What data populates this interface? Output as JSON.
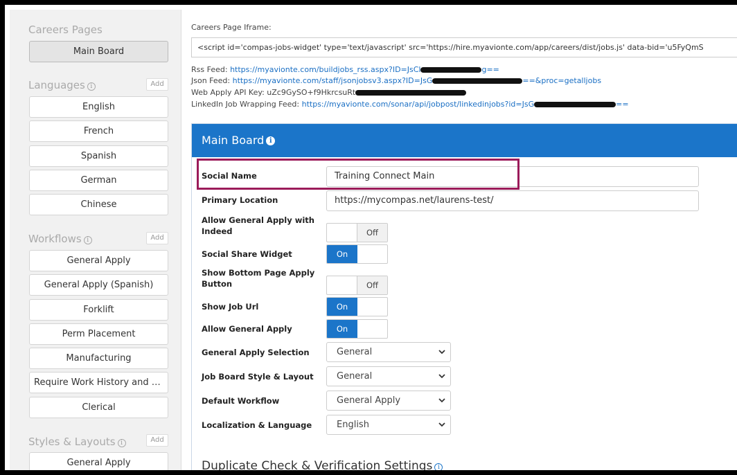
{
  "sidebar": {
    "careers_title": "Careers Pages",
    "careers_items": [
      "Main Board"
    ],
    "languages_title": "Languages",
    "languages_add": "Add",
    "languages": [
      "English",
      "French",
      "Spanish",
      "German",
      "Chinese"
    ],
    "workflows_title": "Workflows",
    "workflows_add": "Add",
    "workflows": [
      "General Apply",
      "General Apply (Spanish)",
      "Forklift",
      "Perm Placement",
      "Manufacturing",
      "Require Work History and E...",
      "Clerical"
    ],
    "styles_title": "Styles & Layouts",
    "styles_add": "Add",
    "styles": [
      "General Apply"
    ]
  },
  "main": {
    "iframe_label": "Careers Page Iframe:",
    "iframe_code": "<script id='compas-jobs-widget' type='text/javascript' src='https://hire.myavionte.com/app/careers/dist/jobs.js' data-bid='u5FyQmS",
    "rss_label": "Rss Feed:",
    "rss_link_a": "https://myavionte.com/buildjobs_rss.aspx?ID=JsCl",
    "rss_link_b": "g==",
    "json_label": "Json Feed:",
    "json_link_a": "https://myavionte.com/staff/jsonjobsv3.aspx?ID=JsG",
    "json_link_b": "==&proc=getalljobs",
    "api_label": "Web Apply API Key:",
    "api_value": "uZc9GySO+f9HkrcsuRt",
    "linkedin_label": "LinkedIn Job Wrapping Feed:",
    "linkedin_link_a": "https://myavionte.com/sonar/api/jobpost/linkedinjobs?id=JsG",
    "linkedin_link_b": "=="
  },
  "panel": {
    "title": "Main Board",
    "fields": {
      "social_name_label": "Social Name",
      "social_name_value": "Training Connect Main",
      "primary_location_label": "Primary Location",
      "primary_location_value": "https://mycompas.net/laurens-test/",
      "allow_indeed_label": "Allow General Apply with Indeed",
      "allow_indeed_state": "Off",
      "social_share_label": "Social Share Widget",
      "social_share_state": "On",
      "bottom_apply_label": "Show Bottom Page Apply Button",
      "bottom_apply_state": "Off",
      "job_url_label": "Show Job Url",
      "job_url_state": "On",
      "allow_general_label": "Allow General Apply",
      "allow_general_state": "On",
      "ga_selection_label": "General Apply Selection",
      "ga_selection_value": "General",
      "style_layout_label": "Job Board Style & Layout",
      "style_layout_value": "General",
      "default_workflow_label": "Default Workflow",
      "default_workflow_value": "General Apply",
      "localization_label": "Localization & Language",
      "localization_value": "English"
    },
    "dup_title": "Duplicate Check & Verification Settings"
  },
  "colors": {
    "accent": "#1b75c9",
    "highlight": "#9b1b5a"
  }
}
